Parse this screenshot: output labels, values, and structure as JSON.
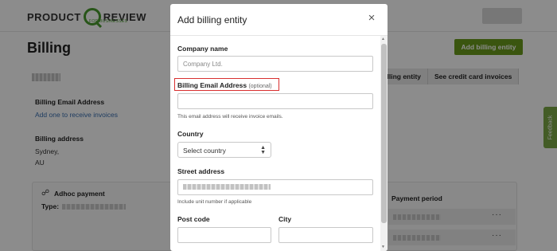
{
  "header": {
    "logo_left": "PRODUCT",
    "logo_right": "REVIEW",
    "logo_tagline": "FOR BUSINESSES"
  },
  "page": {
    "title": "Billing",
    "add_billing_entity_button": "Add billing entity",
    "tabs": [
      "Billing entity",
      "See credit card invoices"
    ],
    "billing_email_label": "Billing Email Address",
    "billing_email_link": "Add one to receive invoices",
    "billing_address_label": "Billing address",
    "billing_address_lines": [
      "Sydney,",
      "AU"
    ],
    "payment_card_title": "Adhoc payment",
    "payment_type_label": "Type:",
    "payment_period_label": "Payment period",
    "row_menu": "···",
    "feedback": "Feedback"
  },
  "modal": {
    "title": "Add billing entity",
    "close_symbol": "×",
    "company_name_label": "Company name",
    "company_name_placeholder": "Company Ltd.",
    "billing_email_label": "Billing Email Address",
    "billing_email_optional": "(optional)",
    "billing_email_help": "This email address will receive invoice emails.",
    "country_label": "Country",
    "country_selected": "Select country",
    "street_label": "Street address",
    "street_help": "Include unit number if applicable",
    "postcode_label": "Post code",
    "city_label": "City"
  },
  "colors": {
    "accent_green": "#6b9b1c",
    "highlight_red": "#d93030",
    "link_blue": "#3a6fb0"
  }
}
